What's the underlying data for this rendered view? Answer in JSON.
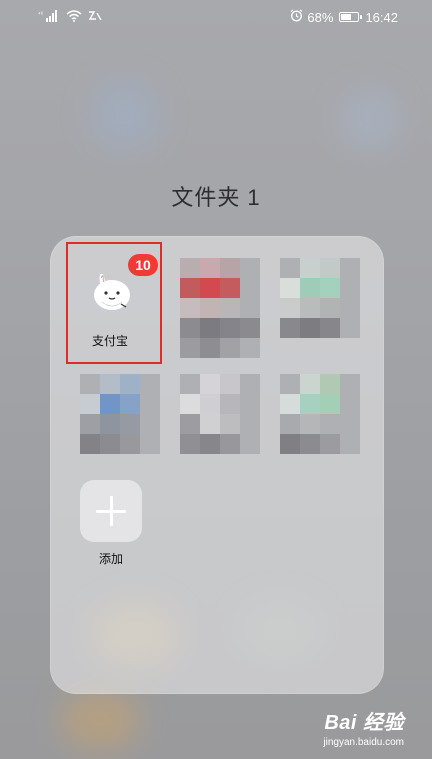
{
  "status_bar": {
    "signal_text": "⁴⁶",
    "battery_percent": "68%",
    "battery_level": 0.68,
    "time": "16:42",
    "icons": [
      "signal-icon",
      "wifi-icon",
      "vibrate-icon",
      "alarm-icon",
      "battery-icon"
    ]
  },
  "folder": {
    "title": "文件夹 1",
    "apps": [
      {
        "label": "支付宝",
        "badge": "10",
        "highlighted": true
      },
      {
        "label": ""
      },
      {
        "label": ""
      },
      {
        "label": ""
      },
      {
        "label": ""
      },
      {
        "label": ""
      }
    ],
    "add_label": "添加"
  },
  "watermark": {
    "main": "Bai 经验",
    "sub": "jingyan.baidu.com"
  },
  "colors": {
    "badge": "#f03a34",
    "highlight": "#e02b2b"
  }
}
